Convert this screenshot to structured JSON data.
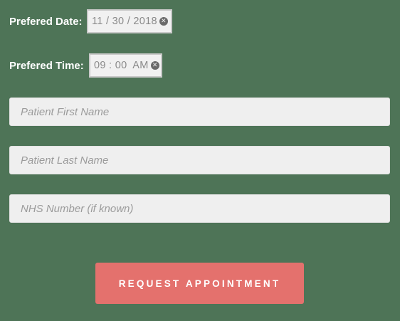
{
  "form": {
    "date_label": "Prefered Date:",
    "date_value": "11 / 30 / 2018",
    "time_label": "Prefered Time:",
    "time_value": "09 : 00  AM",
    "first_name_placeholder": "Patient First Name",
    "last_name_placeholder": "Patient Last Name",
    "nhs_placeholder": "NHS Number (if known)",
    "submit_label": "REQUEST APPOINTMENT",
    "clear_icon_glyph": "✕"
  },
  "colors": {
    "background": "#4e7457",
    "button": "#e4716d",
    "field": "#efefef"
  }
}
